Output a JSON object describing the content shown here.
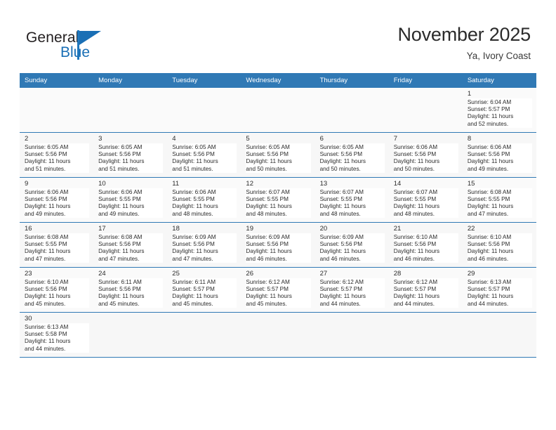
{
  "brand": {
    "name_top": "General",
    "name_bottom": "Blue",
    "accent_color": "#1a6fb5",
    "flag_icon": "flag-triangle-icon"
  },
  "header": {
    "title": "November 2025",
    "subtitle": "Ya, Ivory Coast"
  },
  "calendar": {
    "header_bg": "#3079b5",
    "weekdays": [
      "Sunday",
      "Monday",
      "Tuesday",
      "Wednesday",
      "Thursday",
      "Friday",
      "Saturday"
    ],
    "weeks": [
      [
        {
          "day": "",
          "sunrise": "",
          "sunset": "",
          "daylight": "",
          "daylight2": "",
          "empty": true
        },
        {
          "day": "",
          "sunrise": "",
          "sunset": "",
          "daylight": "",
          "daylight2": "",
          "empty": true
        },
        {
          "day": "",
          "sunrise": "",
          "sunset": "",
          "daylight": "",
          "daylight2": "",
          "empty": true
        },
        {
          "day": "",
          "sunrise": "",
          "sunset": "",
          "daylight": "",
          "daylight2": "",
          "empty": true
        },
        {
          "day": "",
          "sunrise": "",
          "sunset": "",
          "daylight": "",
          "daylight2": "",
          "empty": true
        },
        {
          "day": "",
          "sunrise": "",
          "sunset": "",
          "daylight": "",
          "daylight2": "",
          "empty": true
        },
        {
          "day": "1",
          "sunrise": "Sunrise: 6:04 AM",
          "sunset": "Sunset: 5:57 PM",
          "daylight": "Daylight: 11 hours",
          "daylight2": "and 52 minutes.",
          "empty": false
        }
      ],
      [
        {
          "day": "2",
          "sunrise": "Sunrise: 6:05 AM",
          "sunset": "Sunset: 5:56 PM",
          "daylight": "Daylight: 11 hours",
          "daylight2": "and 51 minutes.",
          "empty": false
        },
        {
          "day": "3",
          "sunrise": "Sunrise: 6:05 AM",
          "sunset": "Sunset: 5:56 PM",
          "daylight": "Daylight: 11 hours",
          "daylight2": "and 51 minutes.",
          "empty": false
        },
        {
          "day": "4",
          "sunrise": "Sunrise: 6:05 AM",
          "sunset": "Sunset: 5:56 PM",
          "daylight": "Daylight: 11 hours",
          "daylight2": "and 51 minutes.",
          "empty": false
        },
        {
          "day": "5",
          "sunrise": "Sunrise: 6:05 AM",
          "sunset": "Sunset: 5:56 PM",
          "daylight": "Daylight: 11 hours",
          "daylight2": "and 50 minutes.",
          "empty": false
        },
        {
          "day": "6",
          "sunrise": "Sunrise: 6:05 AM",
          "sunset": "Sunset: 5:56 PM",
          "daylight": "Daylight: 11 hours",
          "daylight2": "and 50 minutes.",
          "empty": false
        },
        {
          "day": "7",
          "sunrise": "Sunrise: 6:06 AM",
          "sunset": "Sunset: 5:56 PM",
          "daylight": "Daylight: 11 hours",
          "daylight2": "and 50 minutes.",
          "empty": false
        },
        {
          "day": "8",
          "sunrise": "Sunrise: 6:06 AM",
          "sunset": "Sunset: 5:56 PM",
          "daylight": "Daylight: 11 hours",
          "daylight2": "and 49 minutes.",
          "empty": false
        }
      ],
      [
        {
          "day": "9",
          "sunrise": "Sunrise: 6:06 AM",
          "sunset": "Sunset: 5:56 PM",
          "daylight": "Daylight: 11 hours",
          "daylight2": "and 49 minutes.",
          "empty": false
        },
        {
          "day": "10",
          "sunrise": "Sunrise: 6:06 AM",
          "sunset": "Sunset: 5:55 PM",
          "daylight": "Daylight: 11 hours",
          "daylight2": "and 49 minutes.",
          "empty": false
        },
        {
          "day": "11",
          "sunrise": "Sunrise: 6:06 AM",
          "sunset": "Sunset: 5:55 PM",
          "daylight": "Daylight: 11 hours",
          "daylight2": "and 48 minutes.",
          "empty": false
        },
        {
          "day": "12",
          "sunrise": "Sunrise: 6:07 AM",
          "sunset": "Sunset: 5:55 PM",
          "daylight": "Daylight: 11 hours",
          "daylight2": "and 48 minutes.",
          "empty": false
        },
        {
          "day": "13",
          "sunrise": "Sunrise: 6:07 AM",
          "sunset": "Sunset: 5:55 PM",
          "daylight": "Daylight: 11 hours",
          "daylight2": "and 48 minutes.",
          "empty": false
        },
        {
          "day": "14",
          "sunrise": "Sunrise: 6:07 AM",
          "sunset": "Sunset: 5:55 PM",
          "daylight": "Daylight: 11 hours",
          "daylight2": "and 48 minutes.",
          "empty": false
        },
        {
          "day": "15",
          "sunrise": "Sunrise: 6:08 AM",
          "sunset": "Sunset: 5:55 PM",
          "daylight": "Daylight: 11 hours",
          "daylight2": "and 47 minutes.",
          "empty": false
        }
      ],
      [
        {
          "day": "16",
          "sunrise": "Sunrise: 6:08 AM",
          "sunset": "Sunset: 5:55 PM",
          "daylight": "Daylight: 11 hours",
          "daylight2": "and 47 minutes.",
          "empty": false
        },
        {
          "day": "17",
          "sunrise": "Sunrise: 6:08 AM",
          "sunset": "Sunset: 5:56 PM",
          "daylight": "Daylight: 11 hours",
          "daylight2": "and 47 minutes.",
          "empty": false
        },
        {
          "day": "18",
          "sunrise": "Sunrise: 6:09 AM",
          "sunset": "Sunset: 5:56 PM",
          "daylight": "Daylight: 11 hours",
          "daylight2": "and 47 minutes.",
          "empty": false
        },
        {
          "day": "19",
          "sunrise": "Sunrise: 6:09 AM",
          "sunset": "Sunset: 5:56 PM",
          "daylight": "Daylight: 11 hours",
          "daylight2": "and 46 minutes.",
          "empty": false
        },
        {
          "day": "20",
          "sunrise": "Sunrise: 6:09 AM",
          "sunset": "Sunset: 5:56 PM",
          "daylight": "Daylight: 11 hours",
          "daylight2": "and 46 minutes.",
          "empty": false
        },
        {
          "day": "21",
          "sunrise": "Sunrise: 6:10 AM",
          "sunset": "Sunset: 5:56 PM",
          "daylight": "Daylight: 11 hours",
          "daylight2": "and 46 minutes.",
          "empty": false
        },
        {
          "day": "22",
          "sunrise": "Sunrise: 6:10 AM",
          "sunset": "Sunset: 5:56 PM",
          "daylight": "Daylight: 11 hours",
          "daylight2": "and 46 minutes.",
          "empty": false
        }
      ],
      [
        {
          "day": "23",
          "sunrise": "Sunrise: 6:10 AM",
          "sunset": "Sunset: 5:56 PM",
          "daylight": "Daylight: 11 hours",
          "daylight2": "and 45 minutes.",
          "empty": false
        },
        {
          "day": "24",
          "sunrise": "Sunrise: 6:11 AM",
          "sunset": "Sunset: 5:56 PM",
          "daylight": "Daylight: 11 hours",
          "daylight2": "and 45 minutes.",
          "empty": false
        },
        {
          "day": "25",
          "sunrise": "Sunrise: 6:11 AM",
          "sunset": "Sunset: 5:57 PM",
          "daylight": "Daylight: 11 hours",
          "daylight2": "and 45 minutes.",
          "empty": false
        },
        {
          "day": "26",
          "sunrise": "Sunrise: 6:12 AM",
          "sunset": "Sunset: 5:57 PM",
          "daylight": "Daylight: 11 hours",
          "daylight2": "and 45 minutes.",
          "empty": false
        },
        {
          "day": "27",
          "sunrise": "Sunrise: 6:12 AM",
          "sunset": "Sunset: 5:57 PM",
          "daylight": "Daylight: 11 hours",
          "daylight2": "and 44 minutes.",
          "empty": false
        },
        {
          "day": "28",
          "sunrise": "Sunrise: 6:12 AM",
          "sunset": "Sunset: 5:57 PM",
          "daylight": "Daylight: 11 hours",
          "daylight2": "and 44 minutes.",
          "empty": false
        },
        {
          "day": "29",
          "sunrise": "Sunrise: 6:13 AM",
          "sunset": "Sunset: 5:57 PM",
          "daylight": "Daylight: 11 hours",
          "daylight2": "and 44 minutes.",
          "empty": false
        }
      ],
      [
        {
          "day": "30",
          "sunrise": "Sunrise: 6:13 AM",
          "sunset": "Sunset: 5:58 PM",
          "daylight": "Daylight: 11 hours",
          "daylight2": "and 44 minutes.",
          "empty": false
        },
        {
          "day": "",
          "sunrise": "",
          "sunset": "",
          "daylight": "",
          "daylight2": "",
          "empty": true
        },
        {
          "day": "",
          "sunrise": "",
          "sunset": "",
          "daylight": "",
          "daylight2": "",
          "empty": true
        },
        {
          "day": "",
          "sunrise": "",
          "sunset": "",
          "daylight": "",
          "daylight2": "",
          "empty": true
        },
        {
          "day": "",
          "sunrise": "",
          "sunset": "",
          "daylight": "",
          "daylight2": "",
          "empty": true
        },
        {
          "day": "",
          "sunrise": "",
          "sunset": "",
          "daylight": "",
          "daylight2": "",
          "empty": true
        },
        {
          "day": "",
          "sunrise": "",
          "sunset": "",
          "daylight": "",
          "daylight2": "",
          "empty": true
        }
      ]
    ]
  }
}
